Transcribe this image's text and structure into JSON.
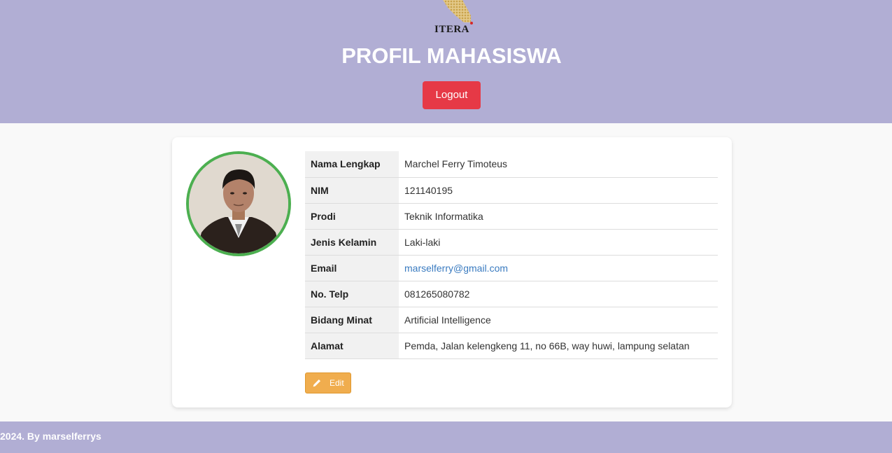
{
  "header": {
    "logo_text": "ITERA",
    "title": "PROFIL MAHASISWA",
    "logout_label": "Logout"
  },
  "profile": {
    "rows": [
      {
        "label": "Nama Lengkap",
        "value": "Marchel Ferry Timoteus"
      },
      {
        "label": "NIM",
        "value": "121140195"
      },
      {
        "label": "Prodi",
        "value": "Teknik Informatika"
      },
      {
        "label": "Jenis Kelamin",
        "value": "Laki-laki"
      },
      {
        "label": "Email",
        "value": "marselferry@gmail.com"
      },
      {
        "label": "No. Telp",
        "value": "081265080782"
      },
      {
        "label": "Bidang Minat",
        "value": "Artificial Intelligence"
      },
      {
        "label": "Alamat",
        "value": "Pemda, Jalan kelengkeng 11, no 66B, way huwi, lampung selatan"
      }
    ],
    "edit_label": "Edit",
    "edit_icon": "pencil-icon"
  },
  "footer": {
    "text": "2024. By marselferrys"
  },
  "colors": {
    "header_bg": "#b1aed4",
    "logout_bg": "#e63946",
    "avatar_border": "#4caf50",
    "edit_bg": "#f0ad4e",
    "link": "#3a7bc0"
  }
}
